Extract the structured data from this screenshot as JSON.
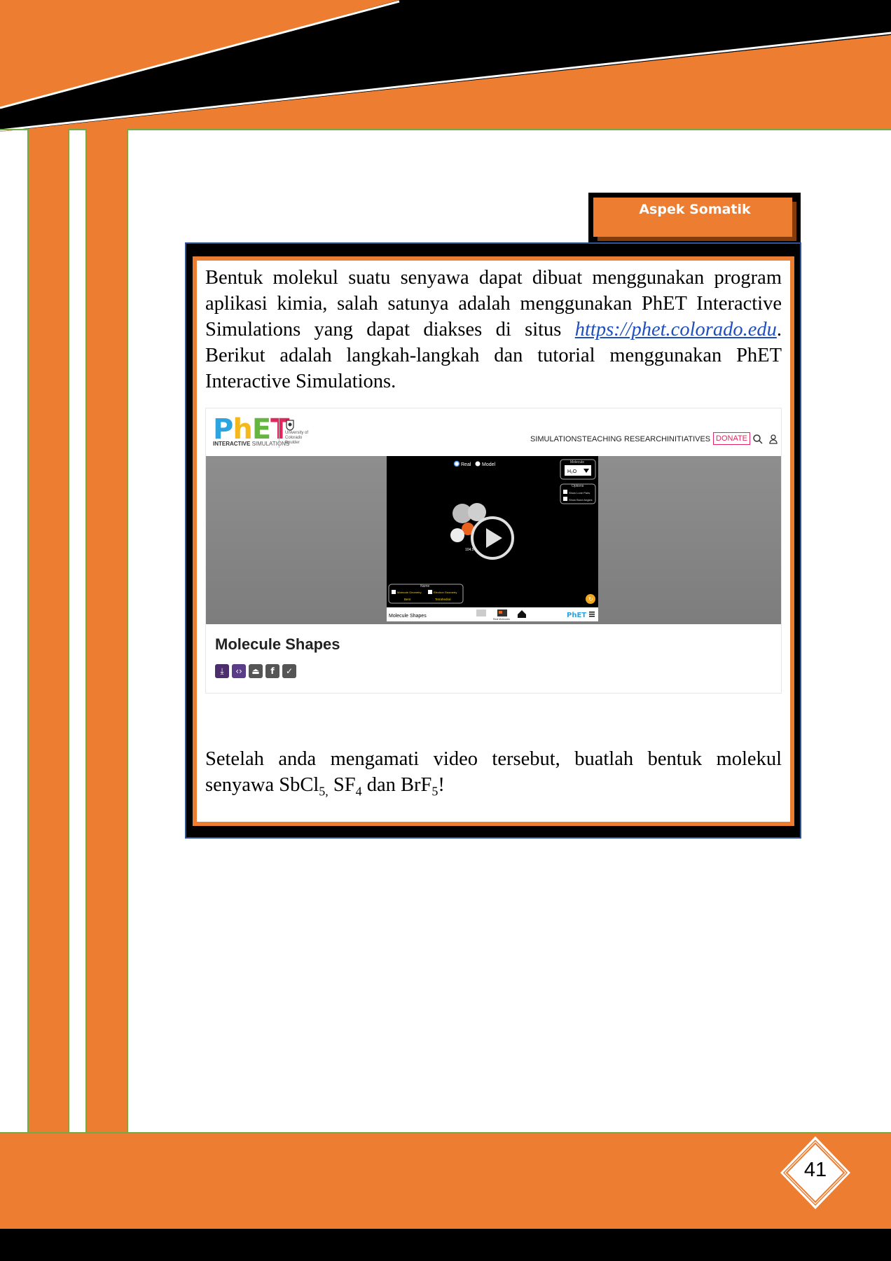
{
  "tab": {
    "label": "Aspek Somatik"
  },
  "intro": {
    "text_before_link": "Bentuk molekul suatu senyawa dapat dibuat menggunakan program aplikasi kimia, salah satunya adalah menggunakan PhET Interactive Simulations yang dapat diakses di situs ",
    "link": "https://phet.colorado.edu",
    "text_after_link": ". Berikut adalah langkah-langkah dan tutorial menggunakan PhET Interactive Simulations."
  },
  "phet_screenshot": {
    "logo": "PhET",
    "logo_subtitle_bold": "INTERACTIVE",
    "logo_subtitle": "SIMULATIONS",
    "university": "University of Colorado Boulder",
    "nav": [
      "SIMULATIONS",
      "TEACHING",
      "RESEARCH",
      "INITIATIVES",
      "DONATE"
    ],
    "video": {
      "radio_real": "Real",
      "radio_model": "Model",
      "molecule_label": "Molecule",
      "molecule_value": "H₂O",
      "options_label": "Options",
      "option_lone_pairs": "Show Lone Pairs",
      "option_bond_angles": "Show Bond Angles",
      "angle_label": "104.5°",
      "name_label": "Name",
      "molecule_geometry": "Molecule Geometry",
      "electron_geometry": "Electron Geometry",
      "molecule_geometry_value": "Bent",
      "electron_geometry_value": "Tetrahedral",
      "sim_title": "Molecule Shapes",
      "screen_label": "Real Molecules"
    },
    "title": "Molecule Shapes"
  },
  "question": {
    "text": "Setelah anda mengamati video tersebut, buatlah bentuk molekul senyawa ",
    "c1": "SbCl",
    "c1_sub": "5,",
    "c2": "SF",
    "c2_sub": "4",
    "mid": "dan ",
    "c3": "BrF",
    "c3_sub": "5",
    "end": "!"
  },
  "page_number": "41",
  "colors": {
    "orange": "#ED7D31",
    "green_border": "#70AD47",
    "black": "#000000",
    "blue_border": "#2F5597"
  }
}
